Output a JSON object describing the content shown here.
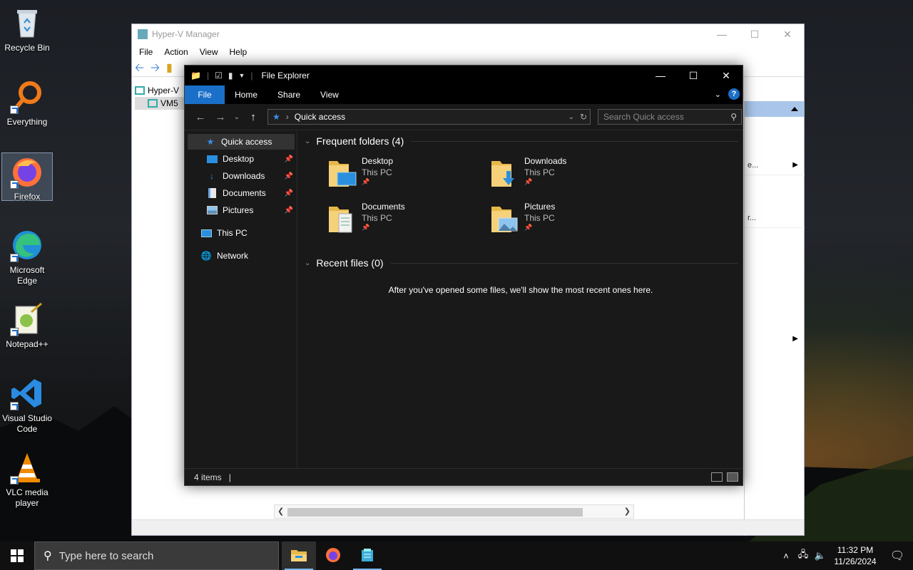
{
  "desktop": {
    "icons": [
      {
        "label": "Recycle Bin"
      },
      {
        "label": "Everything"
      },
      {
        "label": "Firefox"
      },
      {
        "label": "Microsoft Edge"
      },
      {
        "label": "Notepad++"
      },
      {
        "label": "Visual Studio Code"
      },
      {
        "label": "VLC media player"
      }
    ]
  },
  "hyperv": {
    "title": "Hyper-V Manager",
    "menu": [
      "File",
      "Action",
      "View",
      "Help"
    ],
    "tree": [
      "Hyper-V",
      "VM5"
    ],
    "right_rows": [
      "e...",
      "r..."
    ]
  },
  "explorer": {
    "title": "File Explorer",
    "tabs": {
      "file": "File",
      "home": "Home",
      "share": "Share",
      "view": "View"
    },
    "address": "Quick access",
    "search_placeholder": "Search Quick access",
    "sidebar": {
      "quick_access": "Quick access",
      "desktop": "Desktop",
      "downloads": "Downloads",
      "documents": "Documents",
      "pictures": "Pictures",
      "this_pc": "This PC",
      "network": "Network"
    },
    "frequent_header": "Frequent folders (4)",
    "folders": [
      {
        "name": "Desktop",
        "location": "This PC"
      },
      {
        "name": "Downloads",
        "location": "This PC"
      },
      {
        "name": "Documents",
        "location": "This PC"
      },
      {
        "name": "Pictures",
        "location": "This PC"
      }
    ],
    "recent_header": "Recent files (0)",
    "recent_empty": "After you've opened some files, we'll show the most recent ones here.",
    "status": "4 items"
  },
  "taskbar": {
    "search_placeholder": "Type here to search",
    "time": "11:32 PM",
    "date": "11/26/2024"
  },
  "colors": {
    "accent": "#1a6fc8",
    "explorer_bg": "#191919",
    "taskbar_bg": "#101010"
  }
}
